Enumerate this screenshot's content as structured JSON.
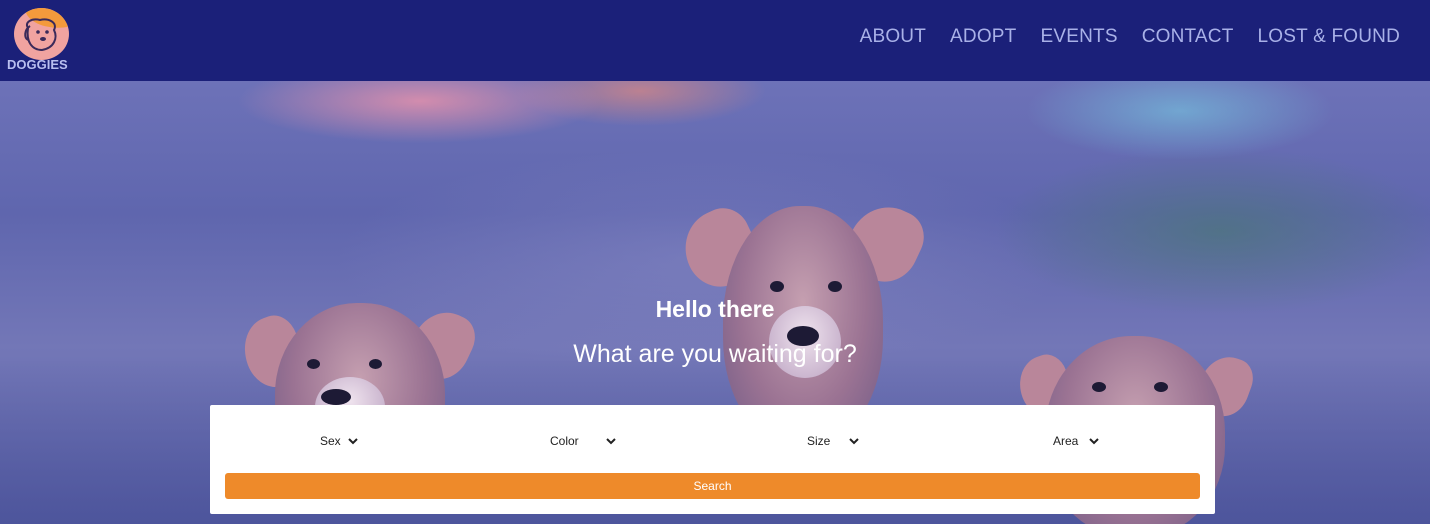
{
  "brand": {
    "name": "DOGGIES"
  },
  "nav": [
    {
      "label": "ABOUT"
    },
    {
      "label": "ADOPT"
    },
    {
      "label": "EVENTS"
    },
    {
      "label": "CONTACT"
    },
    {
      "label": "LOST & FOUND"
    }
  ],
  "hero": {
    "greeting": "Hello there",
    "tagline": "What are you waiting for?"
  },
  "filters": [
    {
      "label": "Sex",
      "icon": "chevron-down-icon"
    },
    {
      "label": "Color",
      "icon": "chevron-down-icon"
    },
    {
      "label": "Size",
      "icon": "chevron-down-icon"
    },
    {
      "label": "Area",
      "icon": "chevron-down-icon"
    }
  ],
  "search": {
    "label": "Search"
  },
  "colors": {
    "header": "#1b2079",
    "nav_text": "#a9b1e8",
    "accent": "#ee8a2a",
    "logo_pink": "#f0a3a0",
    "logo_orange": "#f39a3c"
  }
}
